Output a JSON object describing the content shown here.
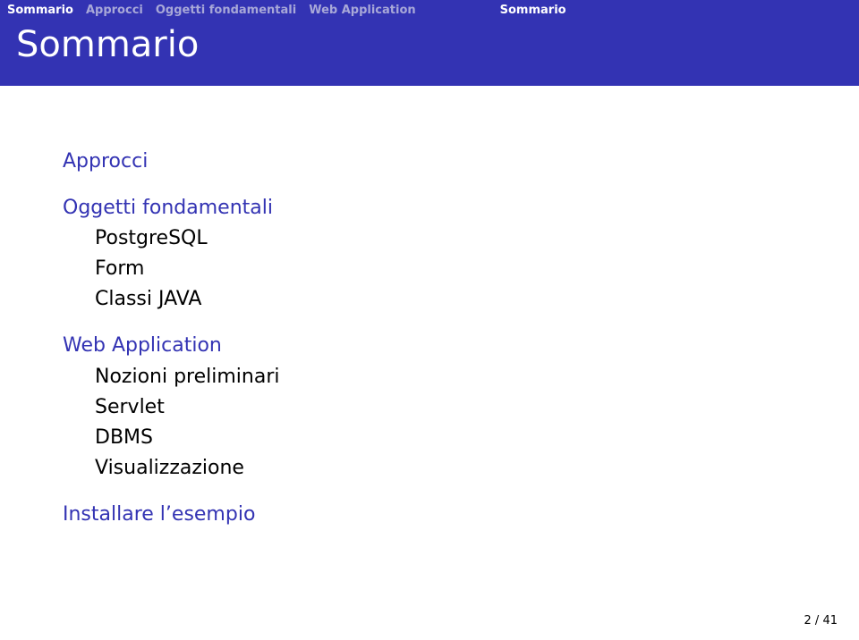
{
  "nav": {
    "items": [
      {
        "label": "Sommario",
        "active": true
      },
      {
        "label": "Approcci",
        "active": false
      },
      {
        "label": "Oggetti fondamentali",
        "active": false
      },
      {
        "label": "Web Application",
        "active": false
      }
    ],
    "subsection": "Sommario"
  },
  "title": "Sommario",
  "outline": {
    "s1": {
      "title": "Approcci",
      "items": []
    },
    "s2": {
      "title": "Oggetti fondamentali",
      "items": [
        "PostgreSQL",
        "Form",
        "Classi JAVA"
      ]
    },
    "s3": {
      "title": "Web Application",
      "items": [
        "Nozioni preliminari",
        "Servlet",
        "DBMS",
        "Visualizzazione"
      ]
    },
    "s4": {
      "title": "Installare l’esempio",
      "items": []
    }
  },
  "page": {
    "current": 2,
    "total": 41,
    "display": "2 / 41"
  }
}
